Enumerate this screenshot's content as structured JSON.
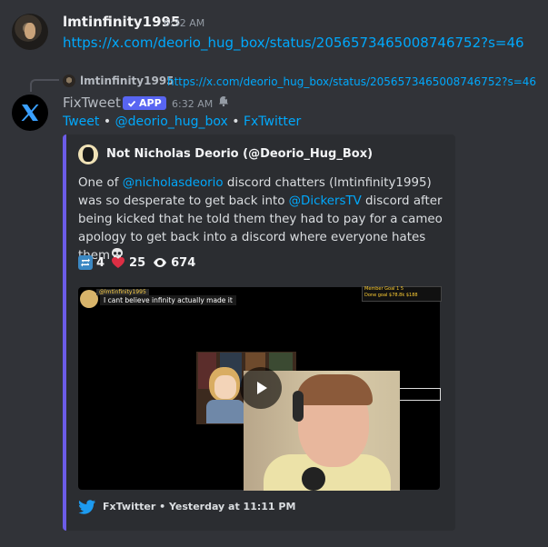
{
  "message1": {
    "username": "lmtinfinity1995",
    "timestamp": "6:32 AM",
    "link": "https://x.com/deorio_hug_box/status/2056573465008746752?s=46"
  },
  "reply": {
    "username": "lmtinfinity1995",
    "link": "https://x.com/deorio_hug_box/status/2056573465008746752?s=46"
  },
  "bot_message": {
    "name": "FixTweet",
    "app_tag": "APP",
    "timestamp": "6:32 AM",
    "links": [
      "Tweet",
      "@deorio_hug_box",
      "FxTwitter"
    ],
    "separator": "•"
  },
  "embed": {
    "accent_color": "#6c5ce7",
    "author": "Not Nicholas Deorio (@Deorio_Hug_Box)",
    "description": {
      "part1": "One of ",
      "mention1": "@nicholasdeorio",
      "part2": " discord chatters (lmtinfinity1995) was so desperate to get back into ",
      "mention2": "@DickersTV",
      "part3": " discord after being kicked that he told them they had to pay for a cameo apology to get back into a discord where everyone hates them"
    },
    "stats": {
      "retweets": "4",
      "likes": "25",
      "views": "674"
    },
    "video_overlay": {
      "chat_name": "@lmtinfinity1995",
      "chat_message": "I cant believe infinity actually made it",
      "goal_label_1": "Member Goal",
      "goal_value_1": "1        5",
      "goal_label_2": "Done goal",
      "goal_value_2": "$78.8k   $188"
    },
    "footer": {
      "source": "FxTwitter",
      "separator": "•",
      "time": "Yesterday at 11:11 PM"
    }
  }
}
